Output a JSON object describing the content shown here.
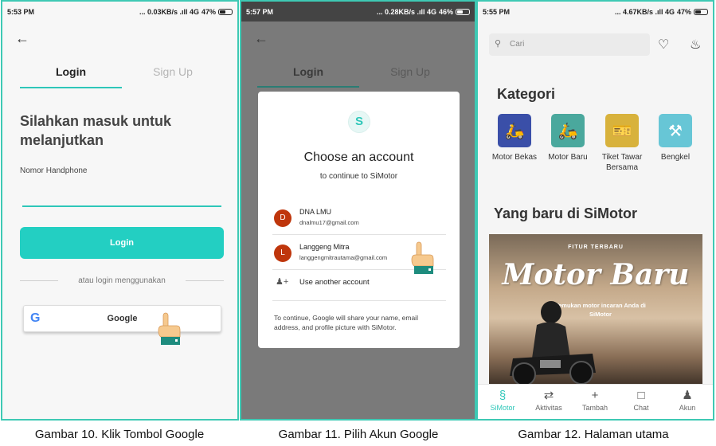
{
  "phone1": {
    "status": {
      "time": "5:53 PM",
      "net": "... 0.03KB/s .ıll 4G",
      "battery": "47%"
    },
    "tabs": {
      "login": "Login",
      "signup": "Sign Up"
    },
    "headline": "Silahkan masuk untuk melanjutkan",
    "phone_label": "Nomor Handphone",
    "phone_value": "",
    "login_button": "Login",
    "or_text": "atau login menggunakan",
    "google_button": "Google"
  },
  "phone2": {
    "status": {
      "time": "5:57 PM",
      "net": "... 0.28KB/s .ıll 4G",
      "battery": "46%"
    },
    "bg_tabs": {
      "login": "Login",
      "signup": "Sign Up"
    },
    "dialog": {
      "title": "Choose an account",
      "subtitle": "to continue to SiMotor",
      "accounts": [
        {
          "initial": "D",
          "name": "DNA LMU",
          "email": "dnalmu17@gmail.com"
        },
        {
          "initial": "L",
          "name": "Langgeng Mitra",
          "email": "langgengmitrautama@gmail.com"
        }
      ],
      "add_account": "Use another account",
      "footer": "To continue, Google will share your name, email address, and profile picture with SiMotor."
    }
  },
  "phone3": {
    "status": {
      "time": "5:55 PM",
      "net": "... 4.67KB/s .ıll 4G",
      "battery": "47%"
    },
    "search_placeholder": "Cari",
    "kategori_title": "Kategori",
    "categories": [
      {
        "label": "Motor Bekas",
        "color": "#3a4fa8",
        "icon": "scooter-icon"
      },
      {
        "label": "Motor Baru",
        "color": "#4aa89d",
        "icon": "scooter-icon"
      },
      {
        "label": "Tiket Tawar Bersama",
        "color": "#d8b23c",
        "icon": "ticket-icon"
      },
      {
        "label": "Bengkel",
        "color": "#67c6d6",
        "icon": "garage-icon"
      }
    ],
    "new_title": "Yang baru di SiMotor",
    "banner": {
      "kicker": "FITUR TERBARU",
      "headline": "Motor Baru",
      "subtext": "Temukan motor incaran Anda di SiMotor"
    },
    "nav": [
      {
        "label": "SiMotor",
        "icon": "simotor-logo-icon"
      },
      {
        "label": "Aktivitas",
        "icon": "arrows-icon"
      },
      {
        "label": "Tambah",
        "icon": "plus-icon"
      },
      {
        "label": "Chat",
        "icon": "chat-icon"
      },
      {
        "label": "Akun",
        "icon": "user-icon"
      }
    ]
  },
  "captions": [
    "Gambar 10. Klik Tombol Google",
    "Gambar 11. Pilih Akun Google",
    "Gambar 12. Halaman utama"
  ],
  "colors": {
    "accent": "#2ec7b9",
    "frame": "#3ec9b4",
    "login_button": "#23cfc2"
  }
}
